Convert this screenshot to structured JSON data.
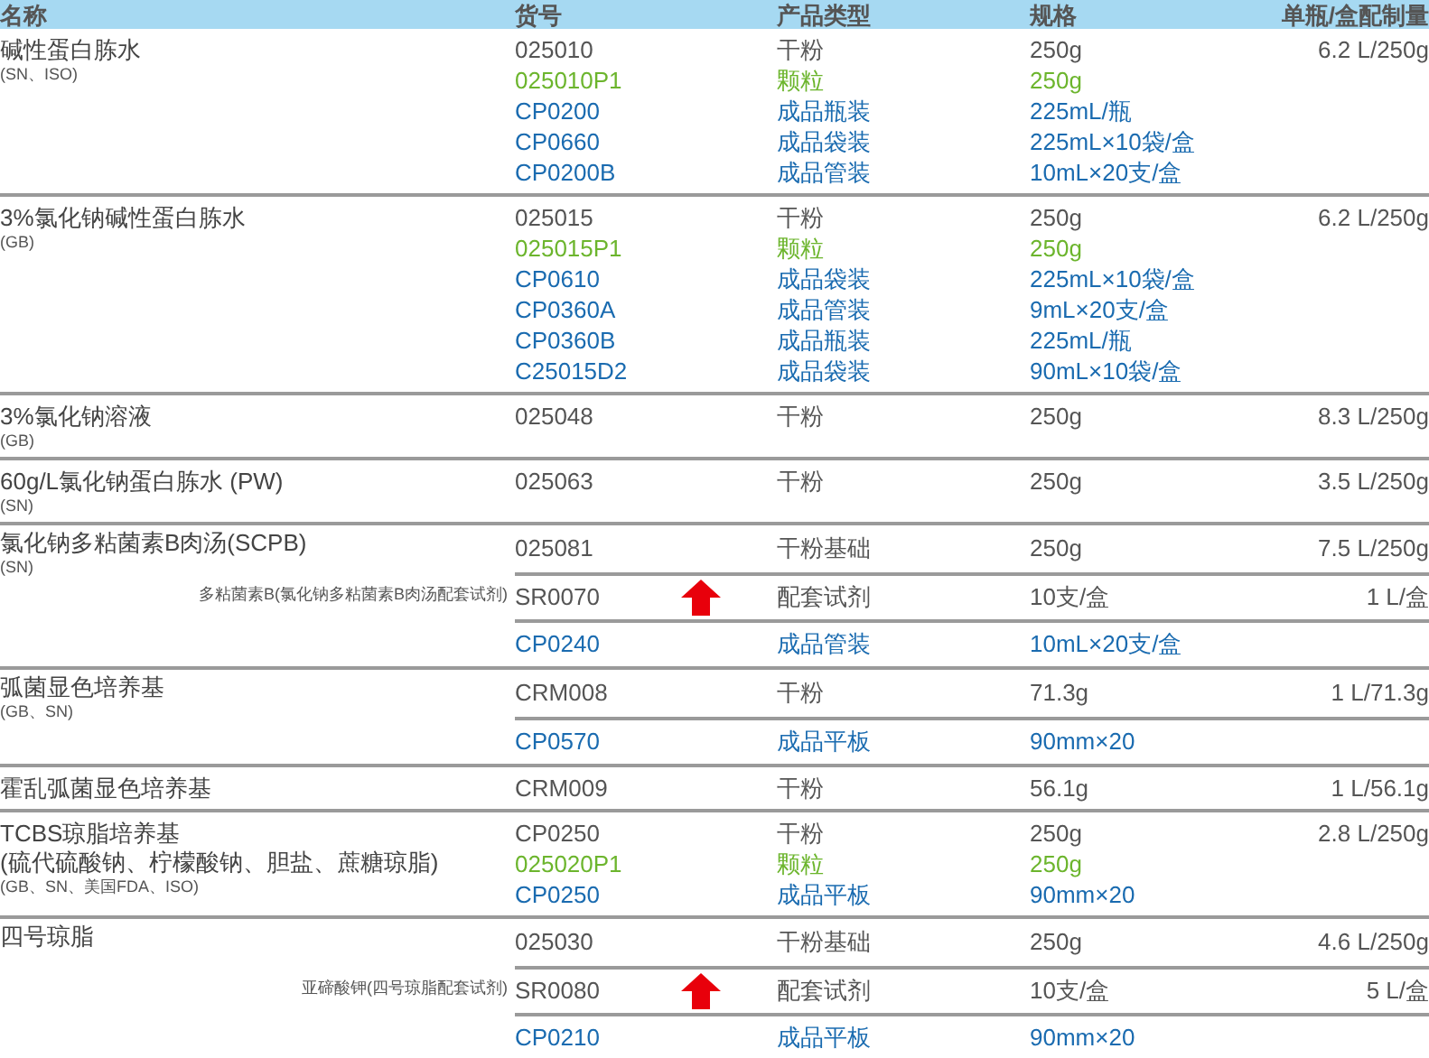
{
  "table": {
    "columns": [
      "名称",
      "货号",
      "产品类型",
      "规格",
      "单瓶/盒配制量"
    ],
    "groups": [
      {
        "name": "碱性蛋白胨水",
        "standard": "(SN、ISO)",
        "ruled": false,
        "items": [
          {
            "kind": "base",
            "code": "025010",
            "type": "干粉",
            "spec": "250g",
            "yield": "6.2 L/250g"
          },
          {
            "kind": "granule",
            "code": "025010P1",
            "type": "颗粒",
            "spec": "250g"
          },
          {
            "kind": "finished",
            "code": "CP0200",
            "type": "成品瓶装",
            "spec": "225mL/瓶"
          },
          {
            "kind": "finished",
            "code": "CP0660",
            "type": "成品袋装",
            "spec": "225mL×10袋/盒"
          },
          {
            "kind": "finished",
            "code": "CP0200B",
            "type": "成品管装",
            "spec": "10mL×20支/盒"
          }
        ]
      },
      {
        "name": "3%氯化钠碱性蛋白胨水",
        "standard": "(GB)",
        "ruled": false,
        "items": [
          {
            "kind": "base",
            "code": "025015",
            "type": "干粉",
            "spec": "250g",
            "yield": "6.2 L/250g"
          },
          {
            "kind": "granule",
            "code": "025015P1",
            "type": "颗粒",
            "spec": "250g"
          },
          {
            "kind": "finished",
            "code": "CP0610",
            "type": "成品袋装",
            "spec": "225mL×10袋/盒"
          },
          {
            "kind": "finished",
            "code": "CP0360A",
            "type": "成品管装",
            "spec": "9mL×20支/盒"
          },
          {
            "kind": "finished",
            "code": "CP0360B",
            "type": "成品瓶装",
            "spec": "225mL/瓶"
          },
          {
            "kind": "finished",
            "code": "C25015D2",
            "type": "成品袋装",
            "spec": "90mL×10袋/盒"
          }
        ]
      },
      {
        "name": "3%氯化钠溶液",
        "standard": "(GB)",
        "ruled": false,
        "items": [
          {
            "kind": "base",
            "code": "025048",
            "type": "干粉",
            "spec": "250g",
            "yield": "8.3 L/250g"
          }
        ]
      },
      {
        "name": "60g/L氯化钠蛋白胨水 (PW)",
        "standard": "(SN)",
        "ruled": false,
        "items": [
          {
            "kind": "base",
            "code": "025063",
            "type": "干粉",
            "spec": "250g",
            "yield": "3.5 L/250g"
          }
        ]
      },
      {
        "name": "氯化钠多粘菌素B肉汤(SCPB)",
        "standard": "(SN)",
        "ruled": true,
        "items": [
          {
            "kind": "base",
            "code": "025081",
            "type": "干粉基础",
            "spec": "250g",
            "yield": "7.5 L/250g"
          },
          {
            "kind": "reagent",
            "note": "多粘菌素B(氯化钠多粘菌素B肉汤配套试剂)",
            "code": "SR0070",
            "type": "配套试剂",
            "spec": "10支/盒",
            "yield": "1 L/盒"
          },
          {
            "kind": "finished",
            "code": "CP0240",
            "type": "成品管装",
            "spec": "10mL×20支/盒"
          }
        ]
      },
      {
        "name": "弧菌显色培养基",
        "standard": "(GB、SN)",
        "ruled": true,
        "items": [
          {
            "kind": "base",
            "code": "CRM008",
            "type": "干粉",
            "spec": "71.3g",
            "yield": "1 L/71.3g"
          },
          {
            "kind": "finished",
            "code": "CP0570",
            "type": "成品平板",
            "spec": "90mm×20"
          }
        ]
      },
      {
        "name": "霍乱弧菌显色培养基",
        "ruled": false,
        "items": [
          {
            "kind": "base",
            "code": "CRM009",
            "type": "干粉",
            "spec": "56.1g",
            "yield": "1 L/56.1g"
          }
        ]
      },
      {
        "name": "TCBS琼脂培养基",
        "subtitle": "(硫代硫酸钠、柠檬酸钠、胆盐、蔗糖琼脂)",
        "standard": "(GB、SN、美国FDA、ISO)",
        "ruled": false,
        "items": [
          {
            "kind": "base",
            "code": "CP0250",
            "type": "干粉",
            "spec": "250g",
            "yield": "2.8 L/250g"
          },
          {
            "kind": "granule",
            "code": "025020P1",
            "type": "颗粒",
            "spec": "250g"
          },
          {
            "kind": "finished",
            "code": "CP0250",
            "type": "成品平板",
            "spec": "90mm×20"
          }
        ]
      },
      {
        "name": "四号琼脂",
        "ruled": true,
        "items": [
          {
            "kind": "base",
            "code": "025030",
            "type": "干粉基础",
            "spec": "250g",
            "yield": "4.6 L/250g"
          },
          {
            "kind": "reagent",
            "note": "亚碲酸钾(四号琼脂配套试剂)",
            "code": "SR0080",
            "type": "配套试剂",
            "spec": "10支/盒",
            "yield": "5 L/盒"
          },
          {
            "kind": "finished",
            "code": "CP0210",
            "type": "成品平板",
            "spec": "90mm×20"
          }
        ]
      }
    ]
  }
}
